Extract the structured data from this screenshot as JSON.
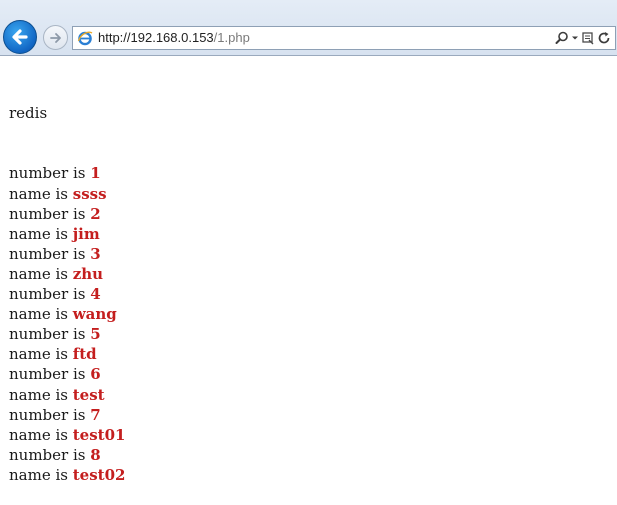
{
  "browser": {
    "url_host": "http://192.168.0.153",
    "url_path": "/1.php",
    "icons": {
      "back": "back-arrow-icon",
      "forward": "forward-arrow-icon",
      "page": "internet-explorer-icon",
      "search": "search-icon",
      "dropdown": "dropdown-arrow-icon",
      "compat": "compatibility-view-icon",
      "refresh": "refresh-icon"
    }
  },
  "page": {
    "heading": "redis",
    "records": [
      {
        "number_label": "number is ",
        "number": "1",
        "name_label": "name is ",
        "name": "ssss"
      },
      {
        "number_label": "number is ",
        "number": "2",
        "name_label": "name is ",
        "name": "jim"
      },
      {
        "number_label": "number is ",
        "number": "3",
        "name_label": "name is ",
        "name": "zhu"
      },
      {
        "number_label": "number is ",
        "number": "4",
        "name_label": "name is ",
        "name": "wang"
      },
      {
        "number_label": "number is ",
        "number": "5",
        "name_label": "name is ",
        "name": "ftd"
      },
      {
        "number_label": "number is ",
        "number": "6",
        "name_label": "name is ",
        "name": "test"
      },
      {
        "number_label": "number is ",
        "number": "7",
        "name_label": "name is ",
        "name": "test01"
      },
      {
        "number_label": "number is ",
        "number": "8",
        "name_label": "name is ",
        "name": "test02"
      }
    ],
    "colors": {
      "value": "#c41e1e",
      "text": "#1a1a1a"
    }
  }
}
